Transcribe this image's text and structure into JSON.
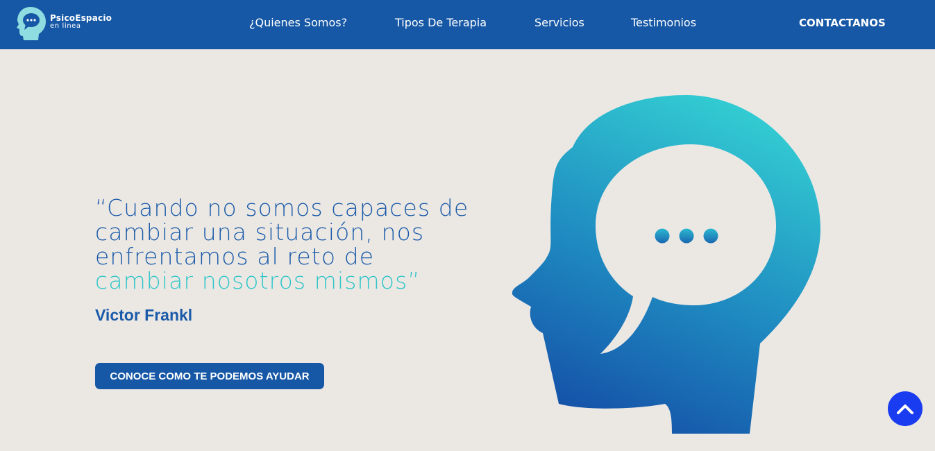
{
  "brand": {
    "name": "PsicoEspacio",
    "tagline": "en linea"
  },
  "nav": {
    "items": [
      "¿Quienes Somos?",
      "Tipos De Terapia",
      "Servicios",
      "Testimonios"
    ],
    "contact": "CONTACTANOS"
  },
  "hero": {
    "quote_lines": [
      "“Cuando no somos capaces de",
      "cambiar una situación, nos",
      "enfrentamos al reto de"
    ],
    "quote_accent": "cambiar nosotros mismos”",
    "author": "Victor Frankl",
    "cta_label": "CONOCE COMO TE PODEMOS AYUDAR"
  },
  "colors": {
    "nav_bg": "#1658a6",
    "page_bg": "#ebe8e4",
    "accent": "#30c6c8",
    "scroll_top": "#1a3cf0"
  },
  "icons": {
    "logo": "head-speech-bubble-icon",
    "scroll_top": "chevron-up-icon"
  }
}
